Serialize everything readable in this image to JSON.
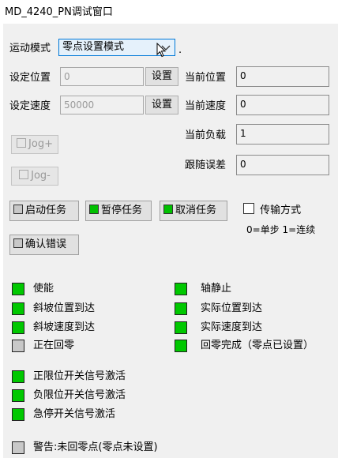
{
  "window": {
    "title": "MD_4240_PN调试窗口"
  },
  "mode": {
    "label": "运动模式",
    "value": "零点设置模式",
    "trailing": "."
  },
  "set_position": {
    "label": "设定位置",
    "value": "0",
    "button": "设置"
  },
  "set_speed": {
    "label": "设定速度",
    "value": "50000",
    "button": "设置"
  },
  "current_position": {
    "label": "当前位置",
    "value": "0"
  },
  "current_speed": {
    "label": "当前速度",
    "value": "0"
  },
  "current_load": {
    "label": "当前负载",
    "value": "1"
  },
  "following_error": {
    "label": "跟随误差",
    "value": "0"
  },
  "jog_plus": "Jog+",
  "jog_minus": "Jog-",
  "tasks": {
    "start": "启动任务",
    "pause": "暂停任务",
    "cancel": "取消任务",
    "confirm_error": "确认错误"
  },
  "transfer": {
    "label": "传输方式",
    "hint": "0=单步 1=连续"
  },
  "status_left": [
    {
      "label": "使能",
      "state": "on"
    },
    {
      "label": "斜坡位置到达",
      "state": "on"
    },
    {
      "label": "斜坡速度到达",
      "state": "on"
    },
    {
      "label": "正在回零",
      "state": "off"
    }
  ],
  "status_right": [
    {
      "label": "轴静止",
      "state": "on"
    },
    {
      "label": "实际位置到达",
      "state": "on"
    },
    {
      "label": "实际速度到达",
      "state": "on"
    },
    {
      "label": "回零完成（零点已设置）",
      "state": "on"
    }
  ],
  "limits": [
    {
      "label": "正限位开关信号激活",
      "state": "on"
    },
    {
      "label": "负限位开关信号激活",
      "state": "on"
    },
    {
      "label": "急停开关信号激活",
      "state": "on"
    }
  ],
  "warning": {
    "label": "警告:未回零点(零点未设置)",
    "state": "off"
  },
  "colors": {
    "led_on": "#00c800",
    "led_off": "#c8c8c8",
    "combo_border": "#0078d7"
  }
}
